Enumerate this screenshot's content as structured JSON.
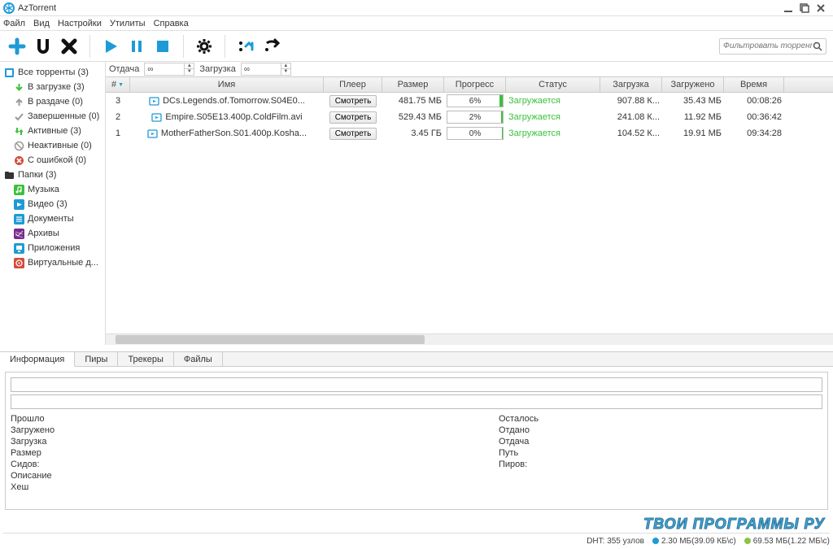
{
  "app": {
    "title": "AzTorrent"
  },
  "menu": {
    "file": "Файл",
    "view": "Вид",
    "settings": "Настройки",
    "utils": "Утилиты",
    "help": "Справка"
  },
  "search": {
    "placeholder": "Фильтровать торренты"
  },
  "speed": {
    "upload_label": "Отдача",
    "upload_val": "∞",
    "download_label": "Загрузка",
    "download_val": "∞"
  },
  "sidebar": {
    "all": "Все торренты (3)",
    "downloading": "В загрузке (3)",
    "seeding": "В раздаче (0)",
    "completed": "Завершенные (0)",
    "active": "Активные (3)",
    "inactive": "Неактивные (0)",
    "error": "С ошибкой (0)",
    "folders": "Папки (3)",
    "music": "Музыка",
    "video": "Видео (3)",
    "docs": "Документы",
    "archives": "Архивы",
    "apps": "Приложения",
    "virtual": "Виртуальные д..."
  },
  "grid": {
    "headers": {
      "num": "#",
      "name": "Имя",
      "player": "Плеер",
      "size": "Размер",
      "progress": "Прогресс",
      "status": "Статус",
      "dl": "Загрузка",
      "dled": "Загружено",
      "time": "Время"
    },
    "rows": [
      {
        "num": "3",
        "name": "DCs.Legends.of.Tomorrow.S04E0...",
        "player": "Смотреть",
        "size": "481.75 МБ",
        "progress": "6%",
        "prog_w": "6%",
        "status": "Загружается",
        "dl": "907.88 К...",
        "dled": "35.43 МБ",
        "time": "00:08:26"
      },
      {
        "num": "2",
        "name": "Empire.S05E13.400p.ColdFilm.avi",
        "player": "Смотреть",
        "size": "529.43 МБ",
        "progress": "2%",
        "prog_w": "3%",
        "status": "Загружается",
        "dl": "241.08 К...",
        "dled": "11.92 МБ",
        "time": "00:36:42"
      },
      {
        "num": "1",
        "name": "MotherFatherSon.S01.400p.Kosha...",
        "player": "Смотреть",
        "size": "3.45 ГБ",
        "progress": "0%",
        "prog_w": "1%",
        "status": "Загружается",
        "dl": "104.52 К...",
        "dled": "19.91 МБ",
        "time": "09:34:28"
      }
    ]
  },
  "tabs": {
    "info": "Информация",
    "peers": "Пиры",
    "trackers": "Трекеры",
    "files": "Файлы"
  },
  "info": {
    "left": {
      "elapsed": "Прошло",
      "downloaded": "Загружено",
      "dl": "Загрузка",
      "size": "Размер",
      "seeds": "Сидов:",
      "desc": "Описание",
      "hash": "Хеш"
    },
    "right": {
      "remaining": "Осталось",
      "uploaded": "Отдано",
      "ul": "Отдача",
      "path": "Путь",
      "peers": "Пиров:"
    }
  },
  "status": {
    "dht": "DHT: 355 узлов",
    "dl": "2.30 МБ(39.09 КБ\\с)",
    "ul": "69.53 МБ(1.22 МБ\\с)"
  },
  "watermark": "ТВОИ ПРОГРАММЫ РУ"
}
